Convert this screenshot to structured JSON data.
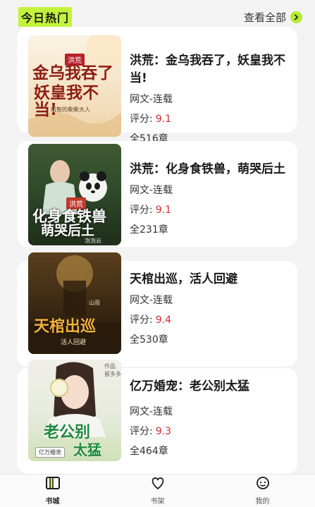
{
  "header": {
    "section_title": "今日热门",
    "see_all_label": "查看全部",
    "accent_color": "#c4f23a"
  },
  "books": [
    {
      "title": "洪荒：金乌我吞了，妖皇我不当!",
      "genre": "网文-连载",
      "rating_label": "评分:",
      "rating": "9.1",
      "chapters": "全516章",
      "cover_text": {
        "tag": "洪荒",
        "line1": "金乌我吞了",
        "line2": "妖皇我不当!",
        "author": "机智的柴柴大人"
      }
    },
    {
      "title": "洪荒：化身食铁兽，萌哭后土",
      "genre": "网文-连载",
      "rating_label": "评分:",
      "rating": "9.1",
      "chapters": "全231章",
      "cover_text": {
        "tag": "洪荒",
        "line1": "化身食铁兽",
        "line2": "萌哭后土",
        "author": "泡泡云"
      }
    },
    {
      "title": "天棺出巡，活人回避",
      "genre": "网文-连载",
      "rating_label": "评分:",
      "rating": "9.4",
      "chapters": "全530章",
      "cover_text": {
        "tag": "",
        "line1": "天棺出巡",
        "line2": "活人回避",
        "author": "山雨"
      }
    },
    {
      "title": "亿万婚宠：老公别太猛",
      "genre": "网文-连载",
      "rating_label": "评分:",
      "rating": "9.3",
      "chapters": "全464章",
      "cover_text": {
        "tag": "亿万婚宠",
        "line1": "老公别",
        "line2": "太猛",
        "author": "作品 留多多"
      }
    }
  ],
  "tabbar": {
    "items": [
      {
        "label": "书城",
        "icon": "book-city-icon",
        "active": true
      },
      {
        "label": "书架",
        "icon": "heart-icon",
        "active": false
      },
      {
        "label": "我的",
        "icon": "smile-face-icon",
        "active": false
      }
    ]
  }
}
